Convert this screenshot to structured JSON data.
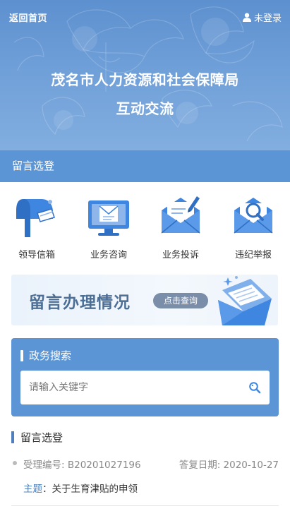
{
  "header": {
    "back_label": "返回首页",
    "login_label": "未登录",
    "title_line1": "茂名市人力资源和社会保障局",
    "title_line2": "互动交流"
  },
  "section_bar": {
    "label": "留言选登"
  },
  "services": [
    {
      "label": "领导信箱",
      "icon": "mailbox-icon"
    },
    {
      "label": "业务咨询",
      "icon": "monitor-mail-icon"
    },
    {
      "label": "业务投诉",
      "icon": "envelope-pen-icon"
    },
    {
      "label": "违纪举报",
      "icon": "envelope-search-icon"
    }
  ],
  "banner": {
    "title": "留言办理情况",
    "button_label": "点击查询"
  },
  "search": {
    "title": "政务搜索",
    "placeholder": "请输入关键字",
    "value": ""
  },
  "messages": {
    "heading": "留言选登",
    "items": [
      {
        "id_label": "受理编号: B20201027196",
        "date_label": "答复日期: 2020-10-27",
        "subject_key": "主题",
        "subject_sep": "：",
        "subject_value": "关于生育津贴的申领"
      }
    ]
  },
  "colors": {
    "brand_blue": "#5b95d5",
    "accent_dark_blue": "#4f80bd",
    "icon_blue": "#3f86e0"
  }
}
